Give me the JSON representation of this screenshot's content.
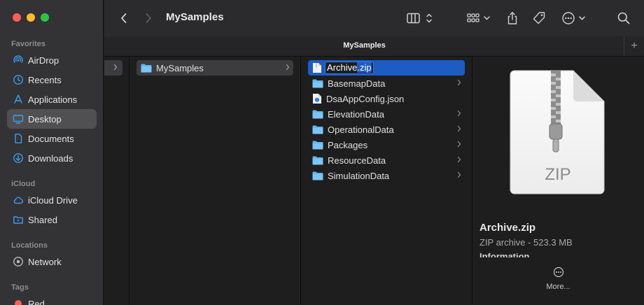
{
  "window": {
    "title": "MySamples",
    "tab_label": "MySamples",
    "tab_add": "+"
  },
  "colors": {
    "accent": "#1d5bc5",
    "sidebar_icon": "#3b9cf2",
    "folder": "#5fb6f3"
  },
  "toolbar": {
    "back_icon": "chevron-left-icon",
    "forward_icon": "chevron-right-icon",
    "view_icon": "column-view-icon",
    "group_icon": "group-grid-icon",
    "share_icon": "share-icon",
    "tag_icon": "tag-icon",
    "action_icon": "ellipsis-circle-icon",
    "search_icon": "search-icon"
  },
  "sidebar": {
    "favorites_title": "Favorites",
    "favorites": [
      {
        "label": "AirDrop",
        "icon": "airdrop-icon"
      },
      {
        "label": "Recents",
        "icon": "clock-icon"
      },
      {
        "label": "Applications",
        "icon": "applications-icon"
      },
      {
        "label": "Desktop",
        "icon": "desktop-icon",
        "selected": true
      },
      {
        "label": "Documents",
        "icon": "document-icon"
      },
      {
        "label": "Downloads",
        "icon": "download-icon"
      }
    ],
    "icloud_title": "iCloud",
    "icloud": [
      {
        "label": "iCloud Drive",
        "icon": "cloud-icon"
      },
      {
        "label": "Shared",
        "icon": "shared-folder-icon"
      }
    ],
    "locations_title": "Locations",
    "locations": [
      {
        "label": "Network",
        "icon": "network-icon"
      }
    ],
    "tags_title": "Tags",
    "tags": [
      {
        "label": "Red",
        "color": "#fe5f57"
      }
    ]
  },
  "columns": {
    "col2": [
      {
        "name": "MySamples",
        "type": "folder",
        "selected": true
      }
    ],
    "col3": [
      {
        "name": "Archive.zip",
        "type": "zip",
        "selected": true,
        "editing": true
      },
      {
        "name": "BasemapData",
        "type": "folder"
      },
      {
        "name": "DsaAppConfig.json",
        "type": "json"
      },
      {
        "name": "ElevationData",
        "type": "folder"
      },
      {
        "name": "OperationalData",
        "type": "folder"
      },
      {
        "name": "Packages",
        "type": "folder"
      },
      {
        "name": "ResourceData",
        "type": "folder"
      },
      {
        "name": "SimulationData",
        "type": "folder"
      }
    ],
    "rename_base": "Archive",
    "rename_ext": ".zip"
  },
  "preview": {
    "icon_label": "ZIP",
    "name": "Archive.zip",
    "kind": "ZIP archive - 523.3 MB",
    "info": "Information",
    "more": "More..."
  }
}
